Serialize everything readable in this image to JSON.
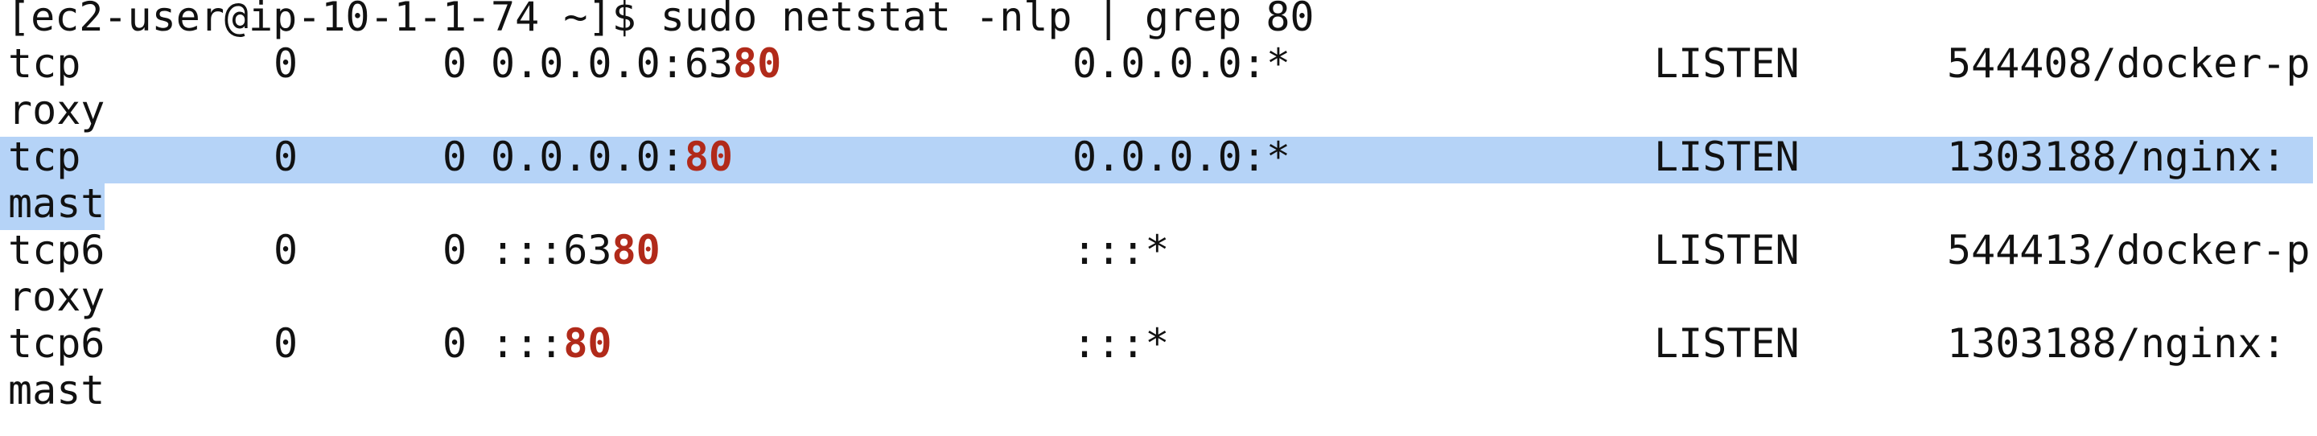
{
  "prompt": {
    "text": "[ec2-user@ip-10-1-1-74 ~]$ sudo netstat -nlp | grep 80"
  },
  "match_color": "#b12a1a",
  "highlight_color": "#b5d3f7",
  "rows": [
    {
      "proto": "tcp",
      "recv_q": "0",
      "send_q": "0",
      "local_pre": "0.0.0.0:63",
      "local_match": "80",
      "local_post": "",
      "foreign": "0.0.0.0:*",
      "state": "LISTEN",
      "pid_line1": "544408/docker-p",
      "pid_line2": "roxy"
    },
    {
      "proto": "tcp",
      "recv_q": "0",
      "send_q": "0",
      "local_pre": "0.0.0.0:",
      "local_match": "80",
      "local_post": "",
      "foreign": "0.0.0.0:*",
      "state": "LISTEN",
      "pid_line1": "1303188/nginx:",
      "pid_line2": "mast"
    },
    {
      "proto": "tcp6",
      "recv_q": "0",
      "send_q": "0",
      "local_pre": ":::63",
      "local_match": "80",
      "local_post": "",
      "foreign": ":::*",
      "state": "LISTEN",
      "pid_line1": "544413/docker-p",
      "pid_line2": "roxy"
    },
    {
      "proto": "tcp6",
      "recv_q": "0",
      "send_q": "0",
      "local_pre": ":::",
      "local_match": "80",
      "local_post": "",
      "foreign": ":::*",
      "state": "LISTEN",
      "pid_line1": "1303188/nginx:",
      "pid_line2": "mast"
    }
  ]
}
